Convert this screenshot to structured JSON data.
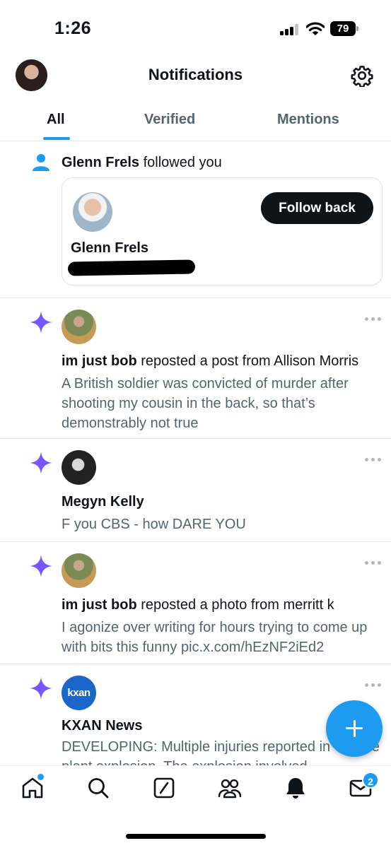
{
  "status_bar": {
    "time": "1:26",
    "battery": "79"
  },
  "header": {
    "title": "Notifications",
    "avatar_icon": "profile-avatar",
    "settings_icon": "gear-icon"
  },
  "tabs": [
    {
      "label": "All",
      "active": true
    },
    {
      "label": "Verified",
      "active": false
    },
    {
      "label": "Mentions",
      "active": false
    }
  ],
  "follow_notification": {
    "name": "Glenn Frels",
    "action": "followed you",
    "card_name": "Glenn Frels",
    "button_label": "Follow back"
  },
  "notifications": [
    {
      "name": "im just bob",
      "action": "reposted a post from Allison Morris",
      "body": "A British soldier was convicted of murder after shooting my cousin in the back, so that’s demonstrably not true"
    },
    {
      "name": "Megyn Kelly",
      "action": "",
      "body": "F you CBS - how DARE YOU"
    },
    {
      "name": "im just bob",
      "action": "reposted a photo from merritt k",
      "body": "I agonize over writing for hours trying to come up with bits this funny pic.x.com/hEzNF2iEd2"
    },
    {
      "name": "KXAN News",
      "action": "",
      "avatar_text": "kxan",
      "body": "DEVELOPING: Multiple injuries reported in Temple plant explosion. The explosion involved"
    }
  ],
  "bottom_nav": {
    "items": [
      "home-icon",
      "search-icon",
      "grok-icon",
      "communities-icon",
      "notifications-bell-icon",
      "messages-icon"
    ],
    "messages_badge": "2"
  },
  "colors": {
    "accent": "#1d9bf0",
    "sparkle": "#7856ff",
    "text": "#0f1419",
    "secondary": "#536471"
  }
}
